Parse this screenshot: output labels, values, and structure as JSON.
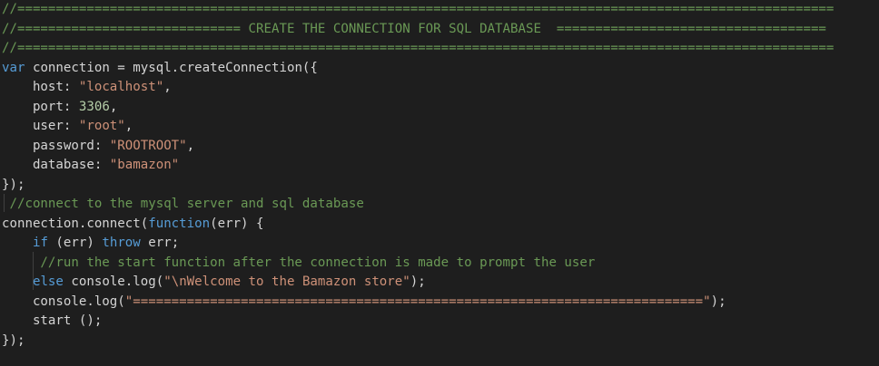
{
  "colors": {
    "background": "#1e1e1e",
    "comment": "#6a9955",
    "keyword": "#569cd6",
    "string": "#ce9178",
    "number": "#b5cea8",
    "text": "#d4d4d4"
  },
  "lines": [
    [
      {
        "t": "//==========================================================================================================",
        "k": "comment"
      }
    ],
    [
      {
        "t": "//============================= CREATE THE CONNECTION FOR SQL DATABASE  ===================================",
        "k": "comment"
      }
    ],
    [
      {
        "t": "//==========================================================================================================",
        "k": "comment"
      }
    ],
    [
      {
        "t": "var",
        "k": "keyword"
      },
      {
        "t": " connection = mysql.createConnection({",
        "k": "plain"
      }
    ],
    [
      {
        "t": "    host: ",
        "k": "plain"
      },
      {
        "t": "\"localhost\"",
        "k": "string"
      },
      {
        "t": ",",
        "k": "plain"
      }
    ],
    [
      {
        "t": "    port: ",
        "k": "plain"
      },
      {
        "t": "3306",
        "k": "number"
      },
      {
        "t": ",",
        "k": "plain"
      }
    ],
    [
      {
        "t": "    user: ",
        "k": "plain"
      },
      {
        "t": "\"root\"",
        "k": "string"
      },
      {
        "t": ",",
        "k": "plain"
      }
    ],
    [
      {
        "t": "    password: ",
        "k": "plain"
      },
      {
        "t": "\"ROOTROOT\"",
        "k": "string"
      },
      {
        "t": ",",
        "k": "plain"
      }
    ],
    [
      {
        "t": "    database: ",
        "k": "plain"
      },
      {
        "t": "\"bamazon\"",
        "k": "string"
      }
    ],
    [
      {
        "t": "});",
        "k": "plain"
      }
    ],
    [
      {
        "t": " //connect to the mysql server and sql database",
        "k": "comment"
      }
    ],
    [
      {
        "t": "connection.connect(",
        "k": "plain"
      },
      {
        "t": "function",
        "k": "keyword"
      },
      {
        "t": "(err) {",
        "k": "plain"
      }
    ],
    [
      {
        "t": "    ",
        "k": "plain"
      },
      {
        "t": "if",
        "k": "keyword"
      },
      {
        "t": " (err) ",
        "k": "plain"
      },
      {
        "t": "throw",
        "k": "keyword"
      },
      {
        "t": " err;",
        "k": "plain"
      }
    ],
    [
      {
        "t": "     //run the start function after the connection is made to prompt the user",
        "k": "comment"
      }
    ],
    [
      {
        "t": "    ",
        "k": "plain"
      },
      {
        "t": "else",
        "k": "keyword"
      },
      {
        "t": " console.log(",
        "k": "plain"
      },
      {
        "t": "\"\\nWelcome to the Bamazon store\"",
        "k": "string"
      },
      {
        "t": ");",
        "k": "plain"
      }
    ],
    [
      {
        "t": "    console.log(",
        "k": "plain"
      },
      {
        "t": "\"==========================================================================\"",
        "k": "string"
      },
      {
        "t": ");",
        "k": "plain"
      }
    ],
    [
      {
        "t": "    start ();",
        "k": "plain"
      }
    ],
    [
      {
        "t": "});",
        "k": "plain"
      }
    ]
  ]
}
